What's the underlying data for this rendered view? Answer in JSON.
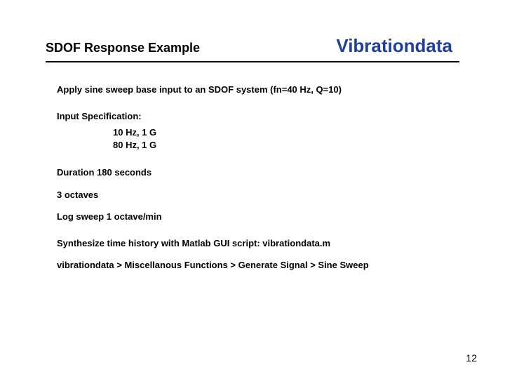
{
  "header": {
    "left_title": "SDOF Response Example",
    "right_brand": "Vibrationdata"
  },
  "body": {
    "intro": "Apply sine sweep base input to an SDOF system (fn=40 Hz, Q=10)",
    "spec_label": "Input Specification:",
    "spec_line1": "10 Hz,  1 G",
    "spec_line2": "80 Hz,  1 G",
    "duration": "Duration 180 seconds",
    "octaves": "3 octaves",
    "sweep": "Log sweep 1 octave/min",
    "synth": "Synthesize time history with Matlab GUI script:  vibrationdata.m",
    "nav": "vibrationdata > Miscellanous Functions > Generate Signal > Sine Sweep"
  },
  "page_number": "12"
}
